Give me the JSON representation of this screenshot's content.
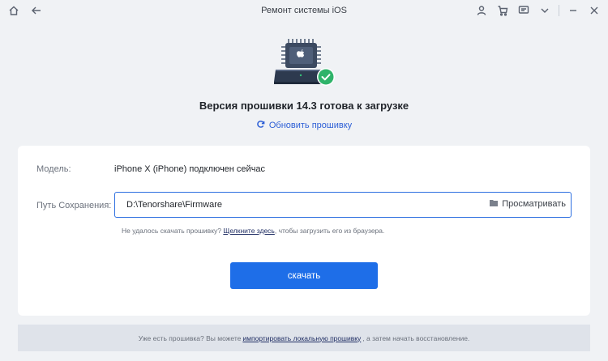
{
  "window": {
    "title": "Ремонт системы iOS"
  },
  "titlebar": {
    "left_icons": [
      "home-icon",
      "back-arrow-icon"
    ],
    "right_icons": [
      "user-icon",
      "cart-icon",
      "feedback-icon",
      "chevron-down-icon",
      "minimize-icon",
      "close-icon"
    ]
  },
  "hero": {
    "headline": "Версия прошивки 14.3 готова к загрузке",
    "refresh_label": "Обновить прошивку"
  },
  "panel": {
    "model_label": "Модель:",
    "model_value": "iPhone X (iPhone) подключен сейчас",
    "path_label": "Путь Сохранения:",
    "path_value": "D:\\Tenorshare\\Firmware",
    "browse_label": "Просматривать",
    "hint_prefix": "Не удалось скачать прошивку?",
    "hint_link": "Щелкните здесь",
    "hint_suffix": ", чтобы загрузить его из браузера.",
    "download_label": "скачать"
  },
  "footer": {
    "prefix": "Уже есть прошивка? Вы можете",
    "link": "импортировать локальную прошивку",
    "suffix": ", а затем начать восстановление."
  },
  "colors": {
    "accent": "#1e6ee8",
    "link": "#2d5fd6",
    "success": "#2fb36a",
    "background": "#f0f2f5"
  }
}
